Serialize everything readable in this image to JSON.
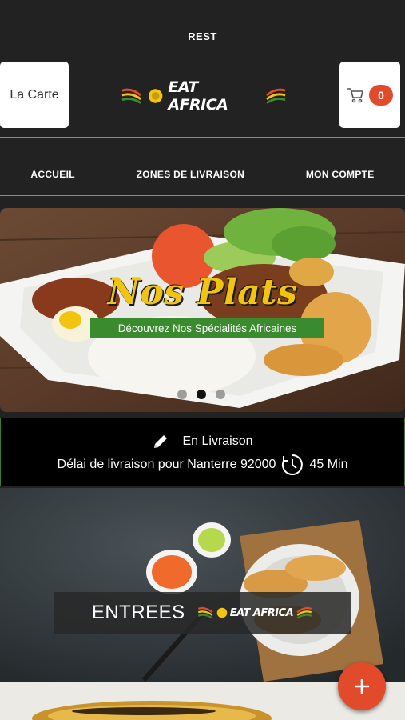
{
  "top": {
    "search_text": "REST"
  },
  "header": {
    "menu_label": "La Carte",
    "cart_count": "0",
    "logo_text": "EAT AFRICA"
  },
  "nav": {
    "items": [
      "ACCUEIL",
      "ZONES DE LIVRAISON",
      "MON COMPTE"
    ]
  },
  "hero": {
    "title": "Nos Plats",
    "subtitle": "Découvrez Nos Spécialités Africaines",
    "active_slide_index": 1,
    "slide_count": 3
  },
  "delivery": {
    "mode": "En Livraison",
    "text": "Délai de livraison pour Nanterre 92000",
    "time": "45 Min"
  },
  "category": {
    "name": "ENTREES",
    "logo_text": "EAT AFRICA"
  },
  "colors": {
    "accent": "#e24a2c",
    "brand_green": "#3a8a2e",
    "hero_title": "#f1c40f",
    "background": "#222222"
  }
}
